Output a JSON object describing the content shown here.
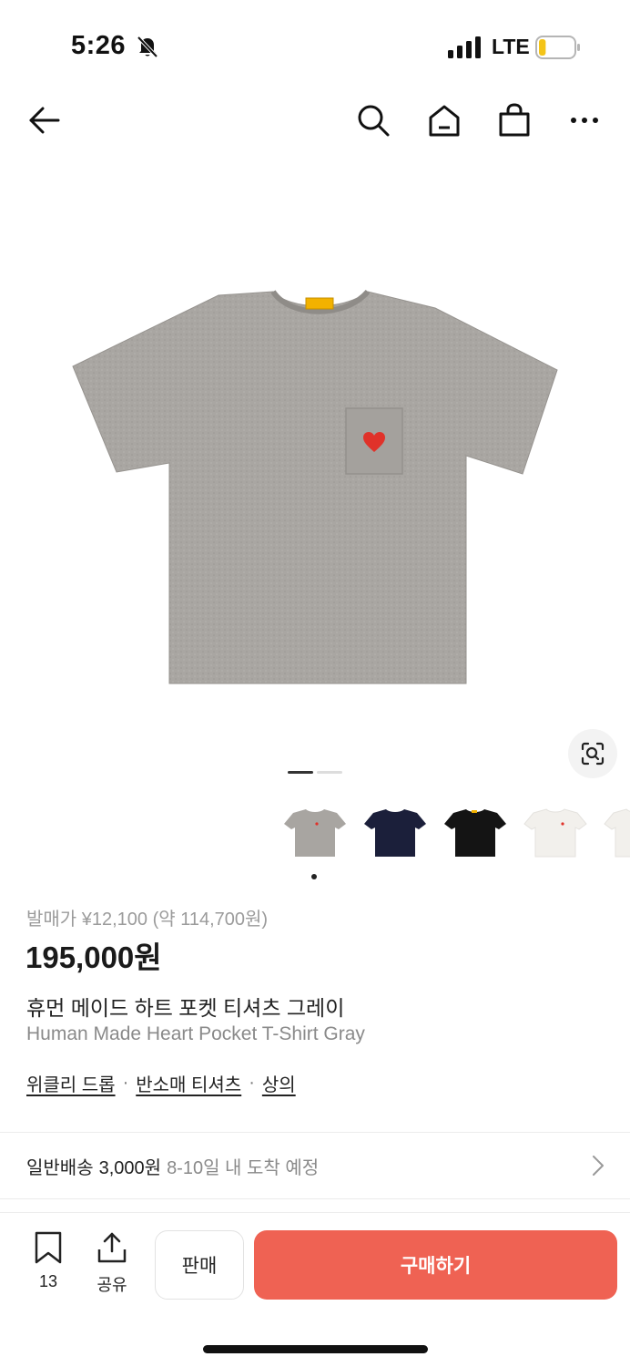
{
  "status": {
    "time": "5:26",
    "network": "LTE",
    "battery_level": 0.2
  },
  "nav": {
    "icons": [
      "back-arrow-icon",
      "search-icon",
      "home-icon",
      "shopping-bag-icon",
      "more-icon"
    ]
  },
  "gallery": {
    "page_count": 2,
    "current_page": 1,
    "thumbnails": [
      {
        "color_name": "gray",
        "hex": "#a8a5a1"
      },
      {
        "color_name": "navy",
        "hex": "#1b1f3a"
      },
      {
        "color_name": "black",
        "hex": "#141414"
      },
      {
        "color_name": "white",
        "hex": "#f2f0ec"
      },
      {
        "color_name": "white",
        "hex": "#f2f0ec"
      }
    ],
    "selected_thumbnail": 0
  },
  "product": {
    "release_price": "발매가 ¥12,100 (약 114,700원)",
    "price": "195,000원",
    "name_ko": "휴먼 메이드 하트 포켓 티셔츠 그레이",
    "name_en": "Human Made Heart Pocket T-Shirt Gray",
    "categories": [
      "위클리 드롭",
      "반소매 티셔츠",
      "상의"
    ],
    "category_separator": "·"
  },
  "shipping": {
    "label": "일반배송",
    "fee": "3,000원",
    "eta": "8-10일 내 도착 예정"
  },
  "bottom_bar": {
    "bookmark_count": "13",
    "share_label": "공유",
    "sell_label": "판매",
    "buy_label": "구매하기"
  },
  "colors": {
    "buy_button": "#ef6253",
    "shirt_gray": "#a8a5a1",
    "heart_red": "#e0322a",
    "label_yellow": "#f2b200"
  }
}
